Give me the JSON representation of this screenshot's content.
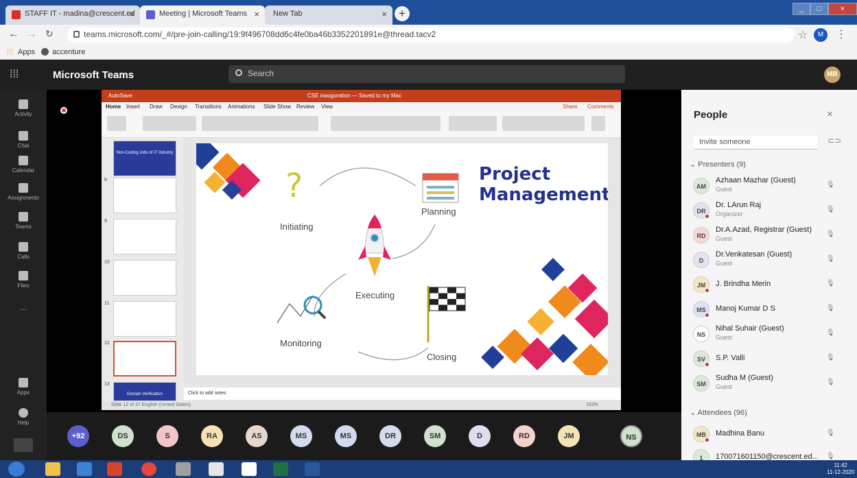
{
  "browser": {
    "tabs": [
      {
        "label": "STAFF IT - madina@crescent.ed",
        "close": "×"
      },
      {
        "label": "Meeting | Microsoft Teams",
        "close": "×"
      },
      {
        "label": "New Tab",
        "close": "×"
      }
    ],
    "new_tab": "+",
    "url": "teams.microsoft.com/_#/pre-join-calling/19:9f496708dd6c4fe0ba46b3352201891e@thread.tacv2",
    "profile_initial": "M",
    "bookmarks": {
      "apps": "Apps",
      "accenture": "accenture"
    }
  },
  "teams": {
    "title": "Microsoft Teams",
    "search_placeholder": "Search",
    "me_initials": "MB",
    "rail": [
      {
        "label": "Activity"
      },
      {
        "label": "Chat"
      },
      {
        "label": "Calendar"
      },
      {
        "label": "Assignments"
      },
      {
        "label": "Teams"
      },
      {
        "label": "Calls"
      },
      {
        "label": "Files"
      },
      {
        "label": "..."
      },
      {
        "label": "Apps"
      },
      {
        "label": "Help"
      }
    ]
  },
  "ppt": {
    "title": "CSE inauguration — Saved to my Mac",
    "autosave": "AutoSave",
    "menu": [
      "Home",
      "Insert",
      "Draw",
      "Design",
      "Transitions",
      "Animations",
      "Slide Show",
      "Review",
      "View"
    ],
    "share": "Share",
    "comments": "Comments",
    "thumb_numbers": [
      "8",
      "9",
      "10",
      "11",
      "12",
      "13"
    ],
    "thumb_first_caption": "Non-Coding Jobs of IT Industry",
    "thumb_last_caption": "Domain Verification",
    "notes": "Click to add notes",
    "status": "Slide 12 of 37   English (United States)",
    "zoom": "103%"
  },
  "slide": {
    "heading_line1": "Project",
    "heading_line2": "Management",
    "phases": {
      "initiating": "Initiating",
      "planning": "Planning",
      "executing": "Executing",
      "monitoring": "Monitoring",
      "closing": "Closing"
    }
  },
  "people": {
    "title": "People",
    "invite_placeholder": "Invite someone",
    "presenters_label": "Presenters (9)",
    "attendees_label": "Attendees (96)",
    "presenters": [
      {
        "initials": "AM",
        "name": "Azhaan Mazhar (Guest)",
        "role": "Guest",
        "color": "#dbe9d8",
        "dot": false
      },
      {
        "initials": "DR",
        "name": "Dr. LArun Raj",
        "role": "Organizer",
        "color": "#dde3f2",
        "dot": true
      },
      {
        "initials": "RD",
        "name": "Dr.A.Azad, Registrar (Guest)",
        "role": "Guest",
        "color": "#f6d9d5",
        "dot": false
      },
      {
        "initials": "D",
        "name": "Dr.Venkatesan (Guest)",
        "role": "Guest",
        "color": "#e6e1f3",
        "dot": false
      },
      {
        "initials": "JM",
        "name": "J. Brindha Merin",
        "role": "",
        "color": "#f5e7c4",
        "dot": true
      },
      {
        "initials": "MS",
        "name": "Manoj Kumar D S",
        "role": "",
        "color": "#dde3f2",
        "dot": true
      },
      {
        "initials": "NS",
        "name": "Nihal Suhair (Guest)",
        "role": "Guest",
        "color": "#ffffff",
        "dot": false
      },
      {
        "initials": "SV",
        "name": "S.P. Valli",
        "role": "",
        "color": "#dbe9d8",
        "dot": true
      },
      {
        "initials": "SM",
        "name": "Sudha M (Guest)",
        "role": "Guest",
        "color": "#dbe9d8",
        "dot": false
      }
    ],
    "attendees": [
      {
        "initials": "MB",
        "name": "Madhina Banu",
        "role": "",
        "color": "#f5e7c4",
        "dot": true
      },
      {
        "initials": "1",
        "name": "170071601150@crescent.ed...",
        "role": "",
        "color": "#dbe9d8",
        "dot": false
      }
    ]
  },
  "strip": [
    {
      "initials": "+92",
      "color": "#5b5fc7"
    },
    {
      "initials": "DS",
      "color": "#cfe3cc"
    },
    {
      "initials": "S",
      "color": "#f3c6c6"
    },
    {
      "initials": "RA",
      "color": "#f5e3b5"
    },
    {
      "initials": "AS",
      "color": "#e6d7cf"
    },
    {
      "initials": "MS",
      "color": "#d5dcef"
    },
    {
      "initials": "MS",
      "color": "#cfdcf0"
    },
    {
      "initials": "DR",
      "color": "#d5dcef"
    },
    {
      "initials": "SM",
      "color": "#cfe3cc"
    },
    {
      "initials": "D",
      "color": "#e2dcf1"
    },
    {
      "initials": "RD",
      "color": "#f4d3cd"
    },
    {
      "initials": "JM",
      "color": "#f5e3b5"
    },
    {
      "initials": "NS",
      "color": "#cfe3cc"
    }
  ],
  "taskbar": {
    "time": "11:42",
    "date": "11-12-2020"
  }
}
